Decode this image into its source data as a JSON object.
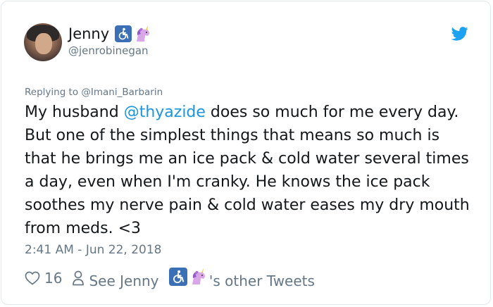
{
  "tweet": {
    "display_name": "Jenny",
    "handle": "@jenrobinegan",
    "replying_prefix": "Replying to ",
    "replying_to": "@Imani_Barbarin",
    "body_before_mention": "My husband ",
    "mention": "@thyazide",
    "body_after_mention": " does so much for me every day. But one of the simplest things that means so much is that he brings me an ice pack & cold water several times a day, even when I'm cranky. He knows the ice pack soothes my nerve pain & cold water eases my dry mouth from meds. <3",
    "timestamp": "2:41 AM - Jun 22, 2018",
    "like_count": "16",
    "see_prefix": "See Jenny",
    "see_suffix": "'s other Tweets"
  },
  "icons": {
    "avatar": "profile-photo",
    "badge_1": "wheelchair-emoji",
    "badge_2": "unicorn-emoji",
    "brand": "twitter-bird-icon",
    "like": "heart-icon",
    "profile": "person-icon"
  },
  "colors": {
    "link": "#1b95e0",
    "muted": "#657786",
    "text": "#14171a",
    "border": "#e1e8ed",
    "wheelchair_badge": "#3b6fb6"
  }
}
